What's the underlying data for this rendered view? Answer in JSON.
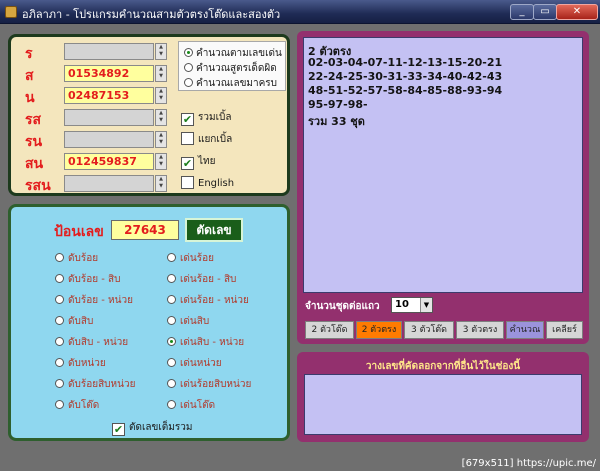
{
  "window": {
    "title": "อภิลาภา - โปรแกรมคำนวณสามตัวตรงโต๊ดและสองตัว",
    "minimize": "_",
    "restore": "▭",
    "close": "✕"
  },
  "inputs": {
    "rows": [
      {
        "label": "ร",
        "value": ""
      },
      {
        "label": "ส",
        "value": "01534892"
      },
      {
        "label": "น",
        "value": "02487153"
      },
      {
        "label": "รส",
        "value": ""
      },
      {
        "label": "รน",
        "value": ""
      },
      {
        "label": "สน",
        "value": "012459837"
      },
      {
        "label": "รสน",
        "value": ""
      }
    ],
    "modes": [
      "คำนวณตามเลขเด่น",
      "คำนวณสูตรเด็ดผิด",
      "คำนวณเลขมาครบ"
    ],
    "selected_mode": 0,
    "checks": [
      {
        "label": "รวมเบิ้ล",
        "checked": true
      },
      {
        "label": "แยกเบิ้ล",
        "checked": false
      },
      {
        "label": "ไทย",
        "checked": true
      },
      {
        "label": "English",
        "checked": false
      }
    ]
  },
  "calc": {
    "number_label": "ป้อนเลข",
    "number_value": "27643",
    "cut_button": "ตัดเลข",
    "left_options": [
      "ดับร้อย",
      "ดับร้อย - สิบ",
      "ดับร้อย - หน่วย",
      "ดับสิบ",
      "ดับสิบ - หน่วย",
      "ดับหน่วย",
      "ดับร้อยสิบหน่วย",
      "ดับโต๊ด"
    ],
    "right_options": [
      "เด่นร้อย",
      "เด่นร้อย - สิบ",
      "เด่นร้อย - หน่วย",
      "เด่นสิบ",
      "เด่นสิบ - หน่วย",
      "เด่นหน่วย",
      "เด่นร้อยสิบหน่วย",
      "เด่นโต๊ด"
    ],
    "selected_right": 4,
    "full_cut_label": "ตัดเลขเต็มรวม",
    "full_cut_checked": true
  },
  "result": {
    "lines": [
      "2 ตัวตรง",
      "02-03-04-07-11-12-13-15-20-21",
      "22-24-25-30-31-33-34-40-42-43",
      "48-51-52-57-58-84-85-88-93-94",
      "95-97-98-",
      "รวม 33 ชุด"
    ],
    "per_row_label": "จำนวนชุดต่อแถว",
    "per_row_value": "10",
    "dropdown_arrow": "▼",
    "tabs": [
      "2 ตัวโต๊ด",
      "2 ตัวตรง",
      "3 ตัวโต๊ด",
      "3 ตัวตรง",
      "คำนวณ",
      "เคลียร์"
    ],
    "active_tab": 1
  },
  "extra": {
    "title": "วางเลขที่คัดลอกจากที่อื่นไว้ในช่องนี้"
  },
  "watermark": "[679x511] https://upic.me/",
  "colors": {
    "title_bar": "#1f2b55",
    "input_panel": "#f4e6bd",
    "button_panel": "#8fd7ef",
    "result_panel": "#93306e",
    "result_area": "#c4c1f3",
    "highlight_field": "#ffff9e",
    "label_red": "#e31d1d",
    "active_tab": "#ff7b00",
    "calc_tab": "#9b93dc"
  }
}
